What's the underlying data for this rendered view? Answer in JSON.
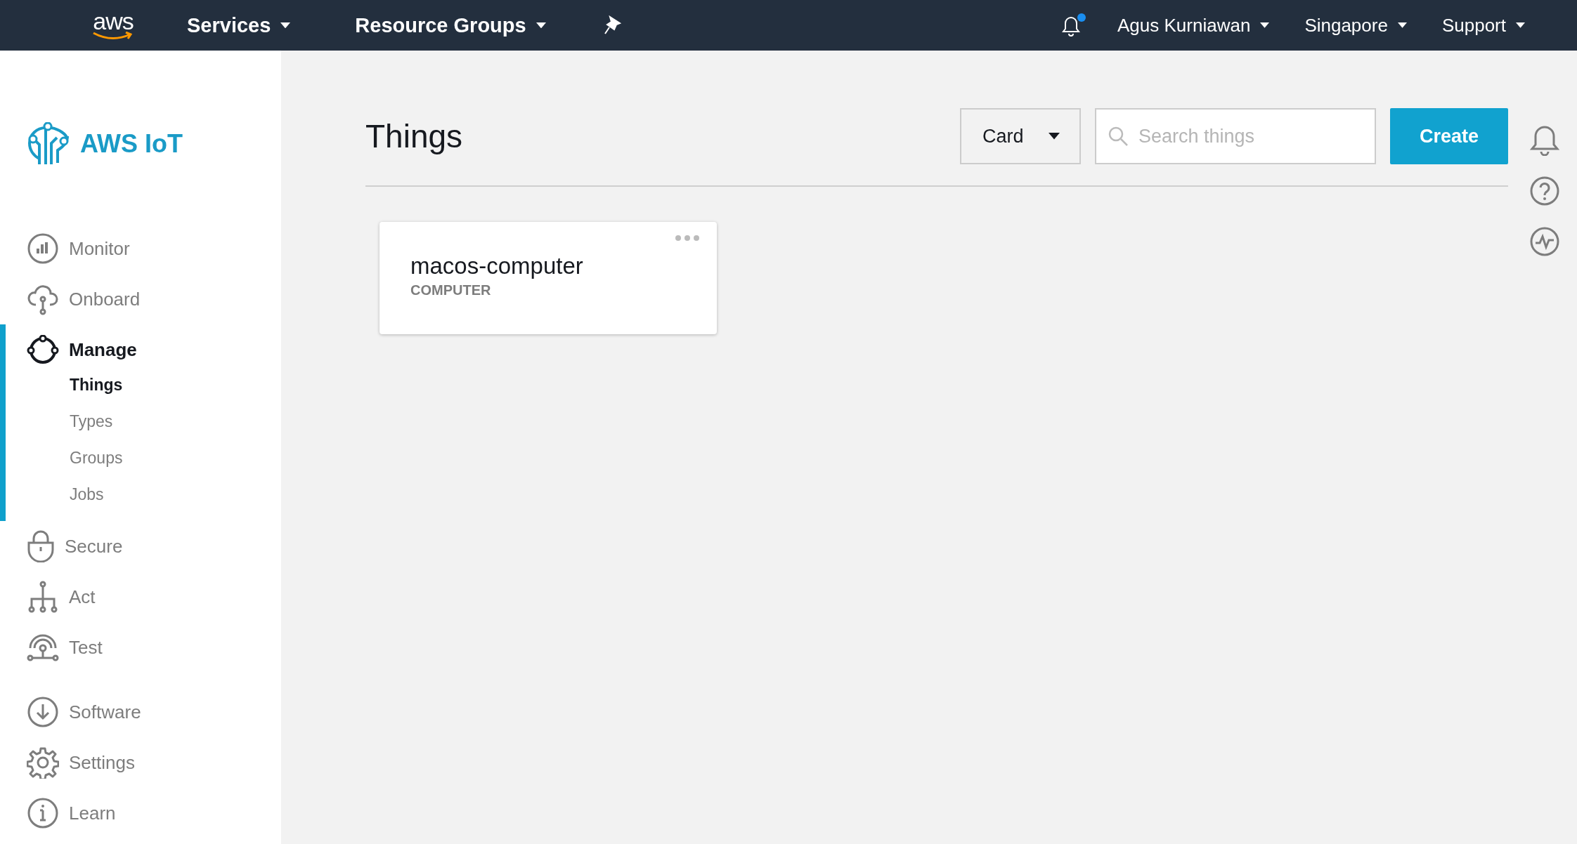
{
  "topbar": {
    "logo": "aws",
    "nav": [
      {
        "label": "Services"
      },
      {
        "label": "Resource Groups"
      }
    ],
    "notifications": {
      "unread": true
    },
    "menus": [
      {
        "label": "Agus Kurniawan"
      },
      {
        "label": "Singapore"
      },
      {
        "label": "Support"
      }
    ]
  },
  "sidebar": {
    "brand": "AWS IoT",
    "sections": [
      [
        {
          "label": "Monitor",
          "selected": false
        },
        {
          "label": "Onboard",
          "selected": false
        },
        {
          "label": "Manage",
          "selected": true,
          "children": [
            {
              "label": "Things",
              "selected": true
            },
            {
              "label": "Types",
              "selected": false
            },
            {
              "label": "Groups",
              "selected": false
            },
            {
              "label": "Jobs",
              "selected": false
            }
          ]
        },
        {
          "label": "Secure",
          "selected": false
        },
        {
          "label": "Act",
          "selected": false
        },
        {
          "label": "Test",
          "selected": false
        }
      ],
      [
        {
          "label": "Software",
          "selected": false
        },
        {
          "label": "Settings",
          "selected": false
        },
        {
          "label": "Learn",
          "selected": false
        }
      ]
    ]
  },
  "page": {
    "title": "Things",
    "view_select": {
      "value": "Card"
    },
    "search": {
      "placeholder": "Search things"
    },
    "create_button": "Create"
  },
  "things": [
    {
      "name": "macos-computer",
      "type": "COMPUTER"
    }
  ]
}
